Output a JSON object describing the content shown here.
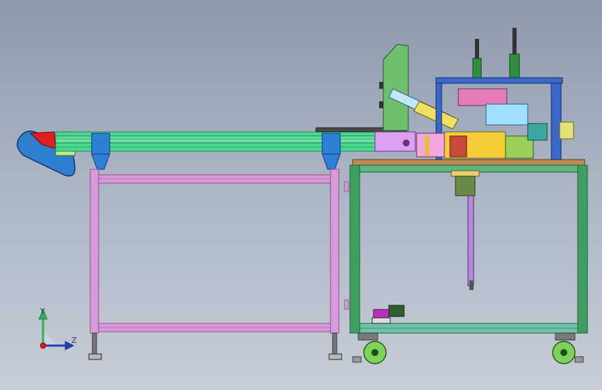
{
  "viewport": {
    "background_top": "#8d99ab",
    "background_bottom": "#c6cdd8"
  },
  "triad": {
    "y_label": "Y",
    "z_label": "Z",
    "y_color": "#2bb24c",
    "z_color": "#1f3fbf",
    "origin_color": "#d01f1f"
  },
  "model": {
    "parts": [
      "belt-conveyor",
      "discharge-chute",
      "conveyor-frame",
      "station-frame",
      "upright-plate",
      "head-frame",
      "cylinders",
      "stepper-motor",
      "solenoid-valve",
      "casters",
      "leveling-feet"
    ],
    "colors": {
      "conveyor_rail": "#49d98f",
      "conveyor_dark": "#2f8f5f",
      "bracket_blue": "#2f7fd6",
      "frame_pink": "#d89ad8",
      "frame_pink_dark": "#8f4f8f",
      "frame_green": "#3f9f5f",
      "frame_green_dark": "#1f5f3a",
      "plate_green": "#6fbf6f",
      "head_blue": "#3a68c8",
      "chute_blue": "#2f7fd0",
      "chute_red": "#e02020",
      "chute_lime": "#b9f08a",
      "caster_wheel": "#7ad35a",
      "motor_yellow": "#e8d070",
      "valve_magenta": "#c02cc0"
    }
  }
}
